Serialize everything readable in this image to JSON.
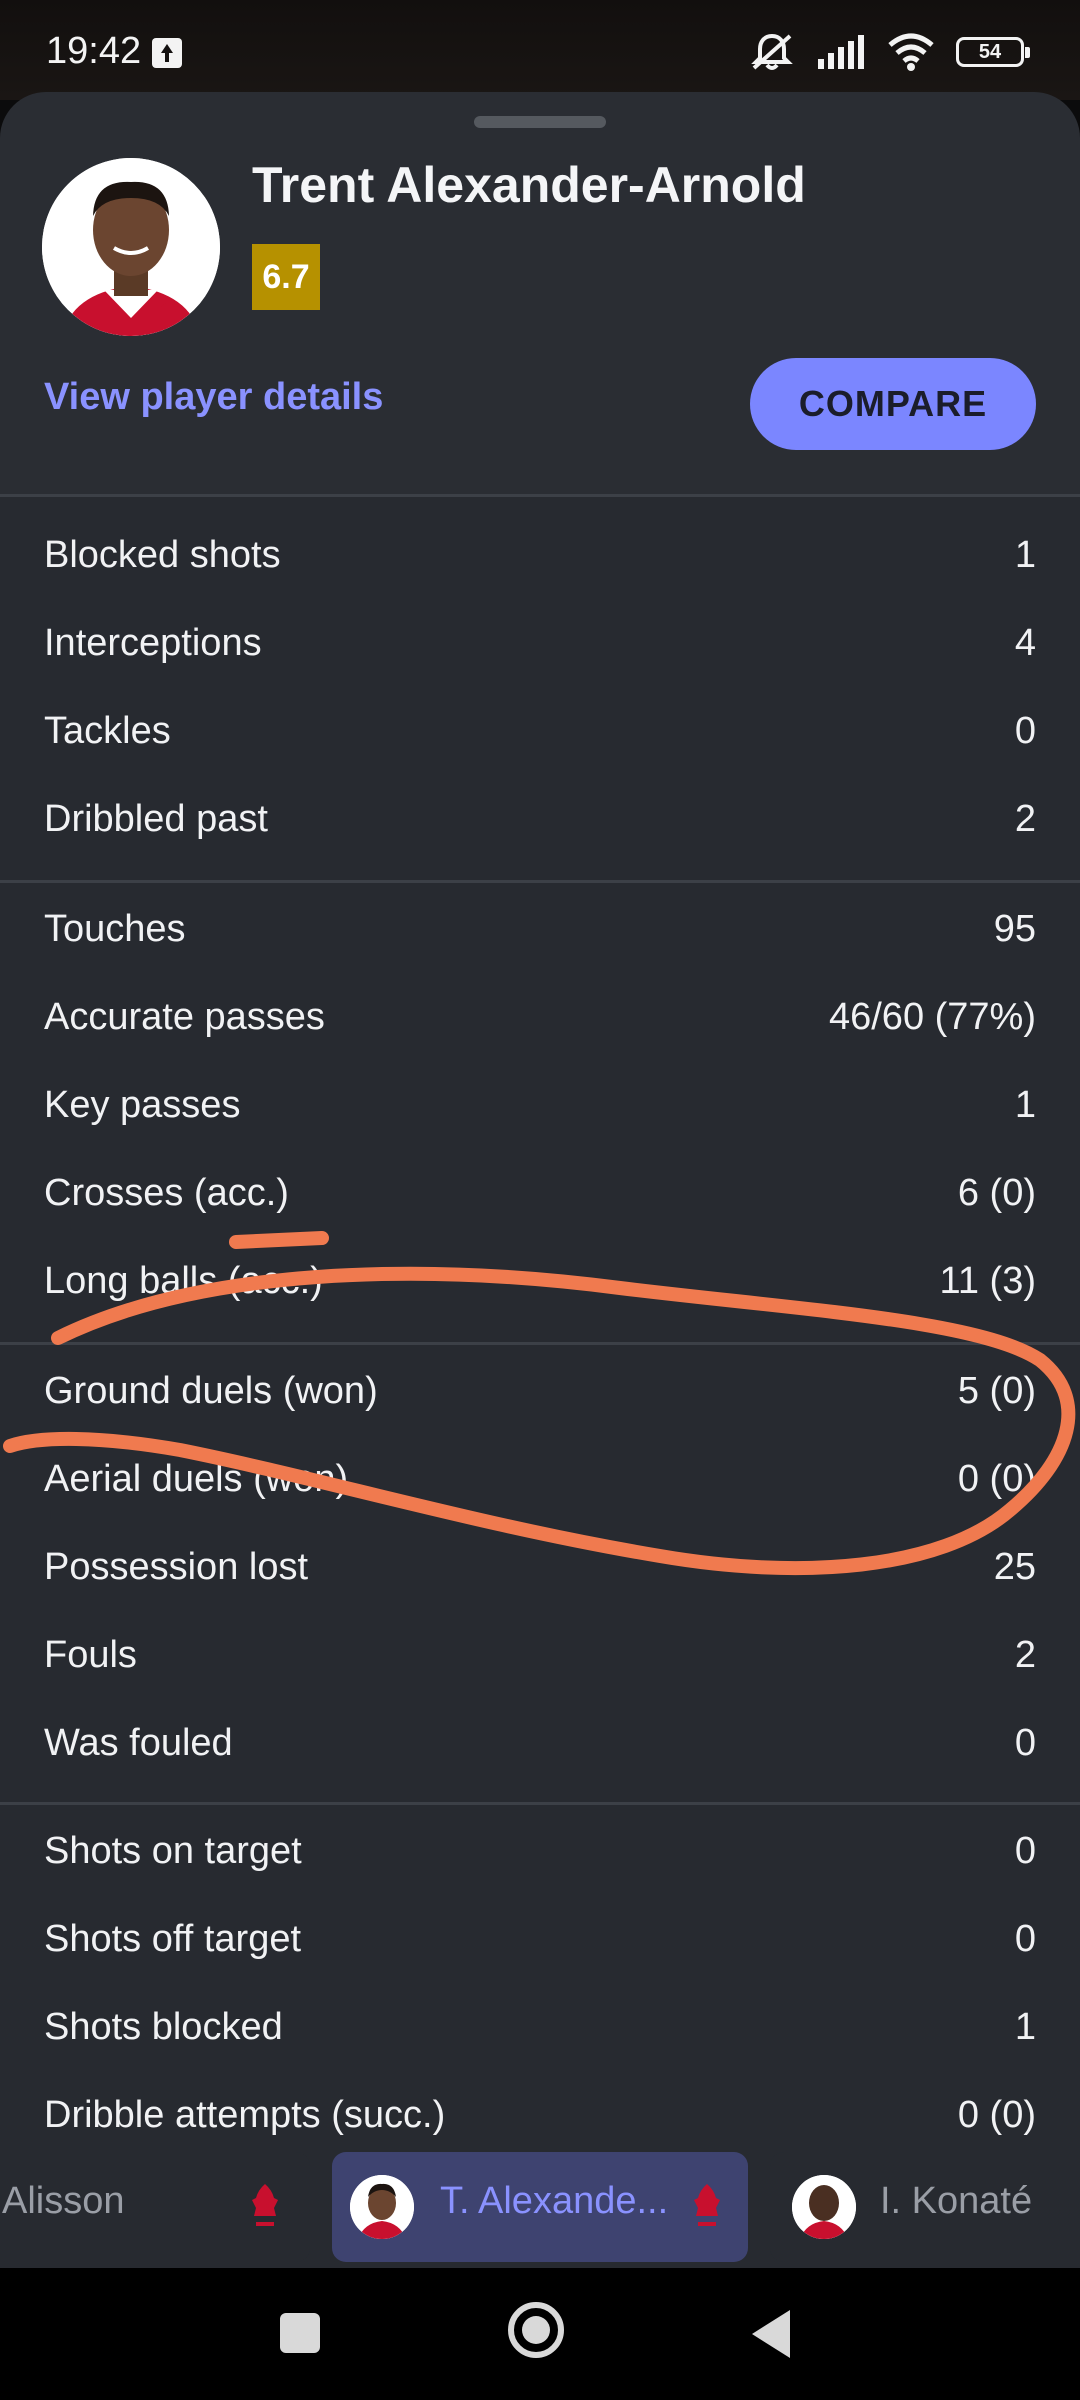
{
  "status_bar": {
    "time": "19:42",
    "battery": "54"
  },
  "player": {
    "name": "Trent Alexander-Arnold",
    "rating": "6.7",
    "club_badge": "LFC"
  },
  "actions": {
    "view_details": "View player details",
    "compare": "COMPARE"
  },
  "stat_groups": [
    [
      {
        "label": "Blocked shots",
        "value": "1"
      },
      {
        "label": "Interceptions",
        "value": "4"
      },
      {
        "label": "Tackles",
        "value": "0"
      },
      {
        "label": "Dribbled past",
        "value": "2"
      }
    ],
    [
      {
        "label": "Touches",
        "value": "95"
      },
      {
        "label": "Accurate passes",
        "value": "46/60 (77%)"
      },
      {
        "label": "Key passes",
        "value": "1"
      },
      {
        "label": "Crosses (acc.)",
        "value": "6 (0)"
      },
      {
        "label": "Long balls (acc.)",
        "value": "11 (3)"
      }
    ],
    [
      {
        "label": "Ground duels (won)",
        "value": "5 (0)"
      },
      {
        "label": "Aerial duels (won)",
        "value": "0 (0)"
      },
      {
        "label": "Possession lost",
        "value": "25"
      },
      {
        "label": "Fouls",
        "value": "2"
      },
      {
        "label": "Was fouled",
        "value": "0"
      }
    ],
    [
      {
        "label": "Shots on target",
        "value": "0"
      },
      {
        "label": "Shots off target",
        "value": "0"
      },
      {
        "label": "Shots blocked",
        "value": "1"
      },
      {
        "label": "Dribble attempts (succ.)",
        "value": "0 (0)"
      }
    ]
  ],
  "switcher": {
    "players": [
      {
        "name": "Alisson",
        "selected": false
      },
      {
        "name": "T. Alexande...",
        "selected": true
      },
      {
        "name": "I. Konaté",
        "selected": false
      }
    ]
  },
  "colors": {
    "accent": "#7b86ff",
    "rating": "#b69100",
    "sheet_bg": "#272a30",
    "annotation": "#f07a4f",
    "club_red": "#c8102e"
  },
  "icons": [
    "upload-icon",
    "mute-icon",
    "signal-icon",
    "wifi-icon",
    "battery-icon",
    "liverpool-crest-icon",
    "recent-apps-icon",
    "home-icon",
    "back-icon"
  ]
}
